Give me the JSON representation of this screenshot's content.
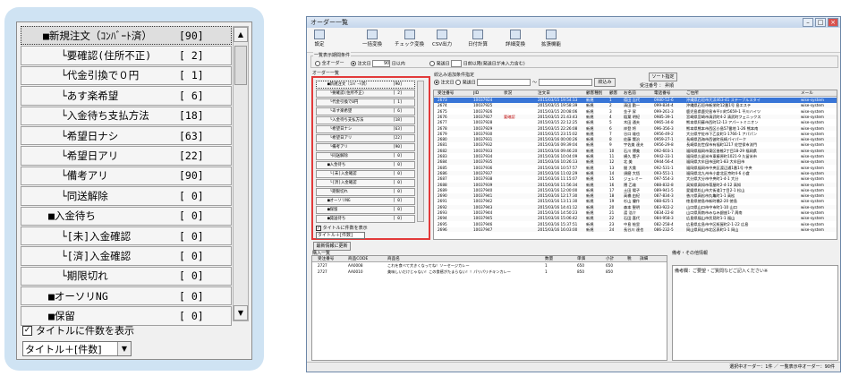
{
  "zoom": {
    "items": [
      {
        "label": "■新規注文（ｺﾝﾊﾞｰﾄ済）",
        "count": "[90]"
      },
      {
        "label": "  └要確認(住所不正)",
        "count": "[ 2]"
      },
      {
        "label": "  └代金引換で０円",
        "count": "[ 1]"
      },
      {
        "label": "  └あす楽希望",
        "count": "[ 6]"
      },
      {
        "label": "  └入金待ち支払方法",
        "count": "[18]"
      },
      {
        "label": "  └希望日ナシ",
        "count": "[63]"
      },
      {
        "label": "  └希望日アリ",
        "count": "[22]"
      },
      {
        "label": "  └備考アリ",
        "count": "[90]"
      },
      {
        "label": "  └同送解除",
        "count": "[ 0]"
      },
      {
        "label": "■入金待ち",
        "count": "[ 0]"
      },
      {
        "label": "  └[未]入金確認",
        "count": "[ 0]"
      },
      {
        "label": "  └[済]入金確認",
        "count": "[ 0]"
      },
      {
        "label": "  └期限切れ",
        "count": "[ 0]"
      },
      {
        "label": "■オーソリNG",
        "count": "[ 0]"
      },
      {
        "label": "■保留",
        "count": "[ 0]"
      }
    ],
    "checkbox_label": "タイトルに件数を表示",
    "checkbox_mark": "✓",
    "select_value": "タイトル＋[件数]",
    "scroll_up": "▲",
    "scroll_down": "▼",
    "dropdown_arrow": "▼"
  },
  "window": {
    "title": "オーダー一覧",
    "min_glyph": "–",
    "max_glyph": "□",
    "close_glyph": "×",
    "toolbar": [
      {
        "label": "設定"
      },
      {
        "label": "一括変換"
      },
      {
        "label": "チェック変換"
      },
      {
        "label": "CSV出力"
      },
      {
        "label": "日付計算"
      },
      {
        "label": "詳細変換"
      },
      {
        "label": "拡張機能"
      }
    ],
    "filter": {
      "group_label": "一覧表示期間条件",
      "opt_all": "全オーダー",
      "opt_order_date": "注文日",
      "days": "90",
      "days_suffix": "日以内",
      "opt_ship_date": "発送日",
      "ship_suffix": "日前以降(発送日が未入力含む)"
    },
    "order_group_label": "オーダー一覧",
    "side_list": [
      {
        "label": "■新規注文（ｺﾝﾊﾞｰﾄ済）",
        "count": "[90]"
      },
      {
        "label": " └要確認(住所不正)",
        "count": "[ 2]"
      },
      {
        "label": " └代金引換で0円",
        "count": "[ 1]"
      },
      {
        "label": " └あす楽希望",
        "count": "[ 6]"
      },
      {
        "label": " └入金待ち支払方法",
        "count": "[18]"
      },
      {
        "label": " └希望日ナシ",
        "count": "[63]"
      },
      {
        "label": " └希望日アリ",
        "count": "[22]"
      },
      {
        "label": " └備考アリ",
        "count": "[90]"
      },
      {
        "label": " └同送解除",
        "count": "[ 0]"
      },
      {
        "label": "■入金待ち",
        "count": "[ 0]"
      },
      {
        "label": " └[未]入金確認",
        "count": "[ 0]"
      },
      {
        "label": " └[済]入金確認",
        "count": "[ 0]"
      },
      {
        "label": " └期限切れ",
        "count": "[ 0]"
      },
      {
        "label": "■オーソリNG",
        "count": "[ 0]"
      },
      {
        "label": "■保留",
        "count": "[ 0]"
      },
      {
        "label": "■発送待ち",
        "count": "[ 0]"
      }
    ],
    "side_checkbox": "タイトルに件数を表示",
    "side_select": "タイトル＋[件数]",
    "refresh_button": "最新情報に更新",
    "narrow": {
      "label": "絞込み追加条件指定",
      "opt_order": "注文日",
      "opt_ship": "発送日",
      "range_sep": "～",
      "search_button": "絞込み",
      "sort_button": "ソート指定",
      "sort_note": "受注番号 ： 昇順"
    },
    "grid_headers": [
      "受注番号",
      "JID",
      "状況",
      "注文日",
      "顧客種別",
      "顧客",
      "お名前",
      "電話番号",
      "ご住所",
      "メール"
    ],
    "grid_rows": [
      [
        "2673",
        "10037924",
        "",
        "2015/03/15 19:54:13",
        "新規",
        "1",
        "德田 吉代",
        "0980-52-6",
        "沖縄県石垣市大浜463-41 ステーブルスタイ",
        "wise-system"
      ],
      [
        "2674",
        "10037925",
        "",
        "2015/03/15 19:58:39",
        "新規",
        "2",
        "清田 勤一",
        "099-834-4",
        "沖縄県石垣市新栄町12番1号 島エステ",
        "wise-system"
      ],
      [
        "2675",
        "10037926",
        "",
        "2015/03/15 20:08:06",
        "新規",
        "3",
        "金子 昇",
        "099-261-3",
        "鹿児島県鹿児島市平川町5659-1 平川ハイツ",
        "wise-system"
      ],
      [
        "2676",
        "10037927",
        "要確認",
        "2015/03/15 21:43:43",
        "新規",
        "4",
        "稲葉 明紀",
        "0985-39-1",
        "宮崎県宮崎市清武町4-2 清武町フェニックス",
        "wise-system"
      ],
      [
        "2677",
        "10037928",
        "",
        "2015/03/15 22:12:25",
        "新規",
        "5",
        "木田 通夫",
        "0965-34-8",
        "熊本県阿蘇市西町12-13 アパートミニオン",
        "wise-system"
      ],
      [
        "2678",
        "10037929",
        "",
        "2015/03/15 22:26:08",
        "新規",
        "6",
        "岸登 将",
        "096-356-3",
        "熊本県熊本市西区小島57番地 1-26 熊本南",
        "wise-system"
      ],
      [
        "2679",
        "10037930",
        "",
        "2015/03/15 23:15:02",
        "新規",
        "7",
        "谷口 雄也",
        "0956-49-2",
        "大分県宇佐市下乙女町1-1766-1 アパパン",
        "wise-system"
      ],
      [
        "2680",
        "10037931",
        "",
        "2015/03/16 00:00:26",
        "新規",
        "8",
        "佐藤 賢治",
        "0959-27-1",
        "長崎県西海市西彼町長崎パイパーク",
        "wise-system"
      ],
      [
        "2681",
        "10037932",
        "",
        "2015/03/16 09:39:04",
        "新規",
        "9",
        "宇佐美 達夫",
        "0956-29-8",
        "長崎県佐世保市有福町1217 佐世保市流門",
        "wise-system"
      ],
      [
        "2682",
        "10037933",
        "",
        "2015/03/16 09:46:20",
        "新規",
        "10",
        "石川 博美",
        "092-603-1",
        "福岡県福岡市東区香椎2丁目18-29 福岡県",
        "wise-system"
      ],
      [
        "2683",
        "10037934",
        "",
        "2015/03/16 10:04:09",
        "新規",
        "11",
        "横久 賢子",
        "0942-33-1",
        "福岡県久留米市東櫛原町1021-9 久留米市",
        "wise-system"
      ],
      [
        "2684",
        "10037935",
        "",
        "2015/03/16 10:26:13",
        "新規",
        "12",
        "北 美",
        "0944-56-4",
        "福岡県大牟田市田町1-83 大牟田市",
        "wise-system"
      ],
      [
        "2685",
        "10037936",
        "",
        "2015/03/16 10:57:57",
        "新規",
        "13",
        "間 大貴",
        "092-531-1",
        "福岡県福岡市中央区渡辺通1番1号 中央",
        "wise-system"
      ],
      [
        "2686",
        "10037937",
        "",
        "2015/03/16 11:02:29",
        "新規",
        "14",
        "須磨 大悟",
        "093-551-1",
        "福岡県北九州市小倉北区京町4-6 小倉",
        "wise-system"
      ],
      [
        "2687",
        "10037938",
        "",
        "2015/03/16 11:15:07",
        "新規",
        "15",
        "ジェレミー",
        "097-554-3",
        "大分県大分市中央町1-4-1 大分",
        "wise-system"
      ],
      [
        "2688",
        "10037939",
        "",
        "2015/03/16 11:56:34",
        "新規",
        "16",
        "隈 乙雄",
        "088-832-8",
        "高知県高知市帯屋町2-4-12 高知",
        "wise-system"
      ],
      [
        "2689",
        "10037940",
        "",
        "2015/03/16 12:00:00",
        "新規",
        "17",
        "土田 陽子",
        "089-941-5",
        "愛媛県松山市大街道1丁目2-1 松山",
        "wise-system"
      ],
      [
        "2690",
        "10037941",
        "",
        "2015/03/16 12:17:30",
        "新規",
        "18",
        "高橋 由紀",
        "087-834-3",
        "香川県高松市丸亀町1-1 高松",
        "wise-system"
      ],
      [
        "2691",
        "10037942",
        "",
        "2015/03/16 13:11:30",
        "新規",
        "19",
        "杉山 優作",
        "088-625-1",
        "徳島県徳島市新町橋2-20 徳島",
        "wise-system"
      ],
      [
        "2692",
        "10037943",
        "",
        "2015/03/16 14:41:12",
        "新規",
        "20",
        "森本 聖明",
        "083-922-2",
        "山口県山口市中市町1-10 山口",
        "wise-system"
      ],
      [
        "2693",
        "10037944",
        "",
        "2015/03/16 14:50:23",
        "新規",
        "21",
        "渡 浩介",
        "0834-22-8",
        "山口県周南市みなみ銀座1-7 周南",
        "wise-system"
      ],
      [
        "2694",
        "10037945",
        "",
        "2015/03/16 15:06:42",
        "新規",
        "22",
        "石田 喜代",
        "084-958-3",
        "広島県福山市伏見町1-1 福山",
        "wise-system"
      ],
      [
        "2695",
        "10037946",
        "",
        "2015/03/16 15:37:51",
        "新規",
        "23",
        "中島 絵里",
        "082-258-4",
        "広島県広島市中区紙屋町2-1-22 広島",
        "wise-system"
      ],
      [
        "2696",
        "10037947",
        "",
        "2015/03/16 16:03:00",
        "新規",
        "24",
        "長谷川 達也",
        "086-232-5",
        "岡山県岡山市北区表町1-1 岡山",
        "wise-system"
      ]
    ],
    "detail_label": "購入一覧",
    "detail_headers": [
      "受注番号",
      "商品CODE",
      "商品名",
      "数量",
      "単価",
      "小計",
      "税",
      "詳細"
    ],
    "detail_rows": [
      [
        "2727",
        "AA0008",
        "これを食べて大きくなってね！ソーセージカレー",
        "1",
        "650",
        "650",
        "",
        ""
      ],
      [
        "2727",
        "AA0010",
        "美味しいだけじゃない！この食感がたまらない！！パリパリチキンカレー",
        "1",
        "850",
        "850",
        "",
        ""
      ]
    ],
    "memo_label": "備考・その他情報",
    "memo_tabs": [
      "備考",
      "通信",
      "ギフト",
      "同送",
      "メモ",
      "警告"
    ],
    "memo_text": "備考欄：ご要望・ご質問などご記入ください※",
    "status_text": "選択中オーダー：1件 ／ 一覧表示中オーダー：90件"
  }
}
